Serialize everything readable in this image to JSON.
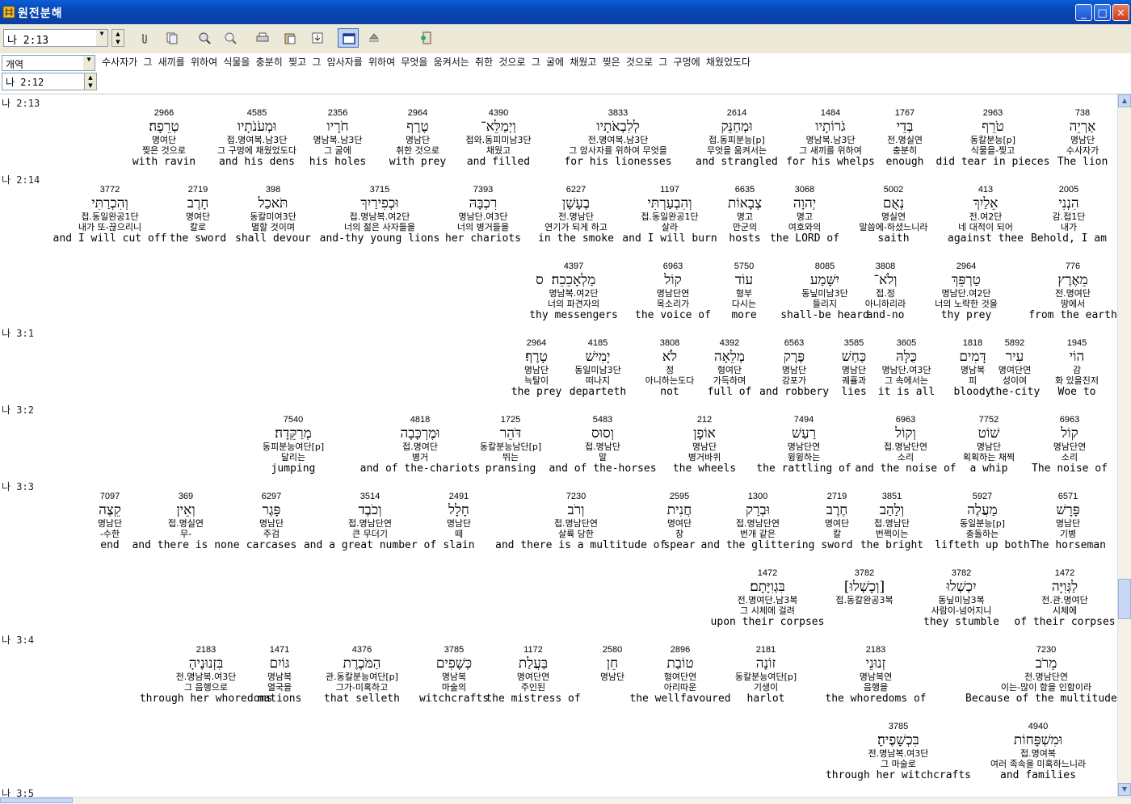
{
  "window": {
    "title": "원전분해",
    "min": "_",
    "max": "□",
    "close": "×"
  },
  "toolbar": {
    "ref_value": "나 2:13",
    "version_value": "개역",
    "prev_ref_value": "나 2:12",
    "buttons": [
      "attach-icon",
      "copy-icon",
      "zoom-in-icon",
      "zoom-out-icon",
      "print-icon",
      "paste-icon",
      "export-icon",
      "window-icon",
      "up-icon",
      "exit-icon"
    ]
  },
  "header": {
    "verse_text": "수사자가 그 새끼를 위하여 식물을 충분히 찢고 그 암사자를 위하여 무엇을 움켜서는 취한 것으로 그 굴에 채웠고 찢은 것으로 그 구멍에 채웠었도다"
  },
  "refs": [
    {
      "label": "나 2:13"
    },
    {
      "label": "나 2:14"
    },
    {
      "label": "나 3:1"
    },
    {
      "label": "나 3:2"
    },
    {
      "label": "나 3:3"
    },
    {
      "label": "나 3:4"
    },
    {
      "label": "나 3:5"
    }
  ],
  "rows": [
    {
      "words": [
        {
          "num": "738",
          "heb": "אַרְיֵה",
          "pars": "명남단",
          "kor": "수사자가",
          "eng": "The lion"
        },
        {
          "num": "2963",
          "heb": "טֹרֵף",
          "pars": "동칼분능[p]",
          "kor": "식물을-찢고",
          "eng": "did tear in pieces"
        },
        {
          "num": "1767",
          "heb": "בְּדֵי",
          "pars": "전.명실연",
          "kor": "충분히",
          "eng": "enough"
        },
        {
          "num": "1484",
          "heb": "גֹרוֹתָיו",
          "pars": "명남복.남3단",
          "kor": "그 새끼를 위하여",
          "eng": "for his whelps"
        },
        {
          "num": "2614",
          "heb": "וּמְחַנֵּק",
          "pars": "접.동피분능[p]",
          "kor": "무엇을 움켜서는",
          "eng": "and strangled"
        },
        {
          "num": "3833",
          "heb": "לְלִבְאֹתָיו",
          "pars": "전.명여복.남3단",
          "kor": "그 암사자를 위하여 무엇을",
          "eng": "for his lionesses"
        },
        {
          "num": "4390",
          "heb": "וַיְמַלֵּא־",
          "pars": "접와.동피미남3단",
          "kor": "채웠고",
          "eng": "and filled"
        },
        {
          "num": "2964",
          "heb": "טֶרֶף",
          "pars": "명남단",
          "kor": "취한 것으로",
          "eng": "with prey"
        },
        {
          "num": "2356",
          "heb": "חֹרָיו",
          "pars": "명남복.남3단",
          "kor": "그 굴에",
          "eng": "his holes"
        },
        {
          "num": "4585",
          "heb": "וּמְעֹנֹתָיו",
          "pars": "접.명여복.남3단",
          "kor": "그 구멍에 채웠었도다",
          "eng": "and his dens"
        },
        {
          "num": "2966",
          "heb": "טְרֵפָה׃",
          "pars": "명여단",
          "kor": "찢은 것으로",
          "eng": "with ravin"
        }
      ]
    },
    {
      "words": [
        {
          "num": "2005",
          "heb": "הִנְנִי",
          "pars": "감.접1단",
          "kor": "내가",
          "eng": "Behold, I am"
        },
        {
          "num": "413",
          "heb": "אֵלַיִךְ",
          "pars": "전.여2단",
          "kor": "네 대적이 되어",
          "eng": "against thee"
        },
        {
          "num": "5002",
          "heb": "נְאֻם",
          "pars": "명실연",
          "kor": "말씀에-하셨느니라",
          "eng": "saith"
        },
        {
          "num": "3068",
          "heb": "יְהוָה",
          "pars": "명고",
          "kor": "여호와의",
          "eng": "the LORD of"
        },
        {
          "num": "6635",
          "heb": "צְבָאוֹת",
          "pars": "명고",
          "kor": "만군의",
          "eng": "hosts"
        },
        {
          "num": "1197",
          "heb": "וְהִבְעַרְתִּי",
          "pars": "접.동일완공1단",
          "kor": "살라",
          "eng": "and I will burn"
        },
        {
          "num": "6227",
          "heb": "בֶעָשָׁן",
          "pars": "전.명남단",
          "kor": "연기가 되게 하고",
          "eng": "in the smoke"
        },
        {
          "num": "7393",
          "heb": "רִכְבָּהּ",
          "pars": "명남단.여3단",
          "kor": "너의 병거들을",
          "eng": "her chariots"
        },
        {
          "num": "3715",
          "heb": "וּכְפִירַיִךְ",
          "pars": "접.명남복.여2단",
          "kor": "너의 젊은 사자들을",
          "eng": "and-thy young lions"
        },
        {
          "num": "398",
          "heb": "תֹּאכַל",
          "pars": "동칼미여3단",
          "kor": "멸할 것이며",
          "eng": "shall devour"
        },
        {
          "num": "2719",
          "heb": "חָרֶב",
          "pars": "명여단",
          "kor": "칼로",
          "eng": "the sword"
        },
        {
          "num": "3772",
          "heb": "וְהִכְרַתִּי",
          "pars": "접.동일완공1단",
          "kor": "내가 또-끊으리니",
          "eng": "and I will cut off"
        }
      ]
    },
    {
      "words": [
        {
          "num": "776",
          "heb": "מֵאֶרֶץ",
          "pars": "전.명여단",
          "kor": "땅에서",
          "eng": "from the earth"
        },
        {
          "num": "2964",
          "heb": "טַרְפֵּךְ",
          "pars": "명남단.여2단",
          "kor": "너의 노략한 것을",
          "eng": "thy prey"
        },
        {
          "num": "3808",
          "heb": "וְלֹא־",
          "pars": "접.정",
          "kor": "아니하리라",
          "eng": "and-no"
        },
        {
          "num": "8085",
          "heb": "יִשָּׁמַע",
          "pars": "동닢미남3단",
          "kor": "들리지",
          "eng": "shall-be heard"
        },
        {
          "num": "5750",
          "heb": "עוֹד",
          "pars": "형부",
          "kor": "다시는",
          "eng": "more"
        },
        {
          "num": "6963",
          "heb": "קוֹל",
          "pars": "명남단연",
          "kor": "목소리가",
          "eng": "the voice of"
        },
        {
          "num": "4397",
          "heb": "מַלְאָכֵכֵה׃",
          "pars": "명남복.여2단",
          "kor": "너의 파견자의",
          "eng": "thy messengers"
        },
        {
          "num": "",
          "heb": "ס",
          "pars": "",
          "kor": "",
          "eng": ""
        }
      ]
    },
    {
      "words": [
        {
          "num": "1945",
          "heb": "הוֹי",
          "pars": "감",
          "kor": "화 있을진저",
          "eng": "Woe to"
        },
        {
          "num": "5892",
          "heb": "עִיר",
          "pars": "명여단연",
          "kor": "성이여",
          "eng": "the-city"
        },
        {
          "num": "1818",
          "heb": "דָּמִים",
          "pars": "명남복",
          "kor": "피",
          "eng": "bloody"
        },
        {
          "num": "3605",
          "heb": "כֻּלָּהּ",
          "pars": "명남단.여3단",
          "kor": "그 속에서는",
          "eng": "it is all"
        },
        {
          "num": "3585",
          "heb": "כַּחַשׁ",
          "pars": "명남단",
          "kor": "궤휼과",
          "eng": "lies"
        },
        {
          "num": "6563",
          "heb": "פֶּרֶק",
          "pars": "명남단",
          "kor": "강포가",
          "eng": "and robbery"
        },
        {
          "num": "4392",
          "heb": "מְלֵאָה",
          "pars": "형여단",
          "kor": "가득하며",
          "eng": "full of"
        },
        {
          "num": "3808",
          "heb": "לֹא",
          "pars": "정",
          "kor": "아니하는도다",
          "eng": "not"
        },
        {
          "num": "4185",
          "heb": "יָמִישׁ",
          "pars": "동일미남3단",
          "kor": "떠나지",
          "eng": "departeth"
        },
        {
          "num": "2964",
          "heb": "טָרֶף׃",
          "pars": "명남단",
          "kor": "늑탈이",
          "eng": "the prey"
        }
      ]
    },
    {
      "words": [
        {
          "num": "6963",
          "heb": "קוֹל",
          "pars": "명남단연",
          "kor": "소리",
          "eng": "The noise of"
        },
        {
          "num": "7752",
          "heb": "שׁוֹט",
          "pars": "명남단",
          "kor": "획획하는 채찍",
          "eng": "a whip"
        },
        {
          "num": "6963",
          "heb": "וְקוֹל",
          "pars": "접.명남단연",
          "kor": "소리",
          "eng": "and the noise of"
        },
        {
          "num": "7494",
          "heb": "רַעַשׁ",
          "pars": "명남단연",
          "kor": "윙윙하는",
          "eng": "the rattling of"
        },
        {
          "num": "212",
          "heb": "אוֹפָן",
          "pars": "명남단",
          "kor": "병거바퀴",
          "eng": "the wheels"
        },
        {
          "num": "5483",
          "heb": "וְסוּס",
          "pars": "접.명남단",
          "kor": "말",
          "eng": "and of the-horses"
        },
        {
          "num": "1725",
          "heb": "דֹּהֵר",
          "pars": "동칼분능남단[p]",
          "kor": "뛰는",
          "eng": "pransing"
        },
        {
          "num": "4818",
          "heb": "וּמֶרְכָּבָה",
          "pars": "접.명여단",
          "kor": "병거",
          "eng": "and of the-chariots"
        },
        {
          "num": "7540",
          "heb": "מְרַקֵּדָה׃",
          "pars": "동피분능여단[p]",
          "kor": "달리는",
          "eng": "jumping"
        }
      ]
    },
    {
      "words": [
        {
          "num": "6571",
          "heb": "פָּרָשׁ",
          "pars": "명남단",
          "kor": "기병",
          "eng": "The horseman"
        },
        {
          "num": "5927",
          "heb": "מַעֲלֶה",
          "pars": "동일분능[p]",
          "kor": "충돌하는",
          "eng": "lifteth up both"
        },
        {
          "num": "3851",
          "heb": "וְלַהַב",
          "pars": "접.명남단",
          "kor": "번쩍이는",
          "eng": "the bright"
        },
        {
          "num": "2719",
          "heb": "חֶרֶב",
          "pars": "명여단",
          "kor": "칼",
          "eng": "sword"
        },
        {
          "num": "1300",
          "heb": "וּבְרַק",
          "pars": "접.명남단연",
          "kor": "번개 같은",
          "eng": "and the glittering"
        },
        {
          "num": "2595",
          "heb": "חֲנִית",
          "pars": "명여단",
          "kor": "창",
          "eng": "spear"
        },
        {
          "num": "7230",
          "heb": "וְרֹב",
          "pars": "접.명남단연",
          "kor": "살륙 당한",
          "eng": "and there is a multitude of"
        },
        {
          "num": "2491",
          "heb": "חָלָל",
          "pars": "명남단",
          "kor": "떼",
          "eng": "slain"
        },
        {
          "num": "3514",
          "heb": "וְכֹבֶד",
          "pars": "접.명남단연",
          "kor": "큰 무더기",
          "eng": "and a great number of"
        },
        {
          "num": "6297",
          "heb": "פָּגֶר",
          "pars": "명남단",
          "kor": "주검",
          "eng": "carcases"
        },
        {
          "num": "369",
          "heb": "וְאֵין",
          "pars": "접.명실연",
          "kor": "무-",
          "eng": "and there is none"
        },
        {
          "num": "7097",
          "heb": "קֵצֶה",
          "pars": "명남단",
          "kor": "-수한",
          "eng": "end"
        }
      ]
    },
    {
      "words": [
        {
          "num": "1472",
          "heb": "לַגְּוִיָּה",
          "pars": "전.관.명여단",
          "kor": "시체에",
          "eng": "of their corpses"
        },
        {
          "num": "3782",
          "heb": "יִכְשְׁלוּ",
          "pars": "동닢미남3복",
          "kor": "사람이-넘어지니",
          "eng": "they stumble"
        },
        {
          "num": "3782",
          "heb": "[וְכָשְׁלוּ]",
          "pars": "접.동칼완공3복",
          "kor": "",
          "eng": ""
        },
        {
          "num": "1472",
          "heb": "בִּגְוִיָּתָם׃",
          "pars": "전.명여단.남3복",
          "kor": "그 시체에 걸려",
          "eng": "upon their corpses"
        }
      ]
    },
    {
      "words": [
        {
          "num": "7230",
          "heb": "מֵרֹב",
          "pars": "전.명남단연",
          "kor": "이는-많이 함을 인함이라",
          "eng": "Because of the multitude of"
        },
        {
          "num": "2183",
          "heb": "זְנוּנֵי",
          "pars": "명남복연",
          "kor": "음행을",
          "eng": "the whoredoms of"
        },
        {
          "num": "2181",
          "heb": "זוֹנָה",
          "pars": "동칼분능여단[p]",
          "kor": "기생이",
          "eng": "harlot"
        },
        {
          "num": "2896",
          "heb": "טוֹבַת",
          "pars": "형여단연",
          "kor": "아리따운",
          "eng": "the wellfavoured"
        },
        {
          "num": "2580",
          "heb": "חֵן",
          "pars": "명남단",
          "kor": "",
          "eng": ""
        },
        {
          "num": "1172",
          "heb": "בַּעֲלַת",
          "pars": "명여단연",
          "kor": "주인된",
          "eng": "the mistress of"
        },
        {
          "num": "3785",
          "heb": "כְּשָׁפִים",
          "pars": "명남복",
          "kor": "마술의",
          "eng": "witchcrafts"
        },
        {
          "num": "4376",
          "heb": "הַמֹּכֶרֶת",
          "pars": "관.동칼분능여단[p]",
          "kor": "그가-미혹하고",
          "eng": "that selleth"
        },
        {
          "num": "1471",
          "heb": "גּוֹיִם",
          "pars": "명남복",
          "kor": "열국을",
          "eng": "nations"
        },
        {
          "num": "2183",
          "heb": "בִּזְנוּנֶיהָ",
          "pars": "전.명남복.여3단",
          "kor": "그 음행으로",
          "eng": "through her whoredoms"
        }
      ]
    },
    {
      "words": [
        {
          "num": "4940",
          "heb": "וּמִשְׁפָּחוֹת",
          "pars": "접.명여복",
          "kor": "여러 족속을 미혹하느니라",
          "eng": "and families"
        },
        {
          "num": "3785",
          "heb": "בִּכְשָׁפֶיהָ׃",
          "pars": "전.명남복.여3단",
          "kor": "그 마술로",
          "eng": "through her witchcrafts"
        }
      ]
    }
  ]
}
